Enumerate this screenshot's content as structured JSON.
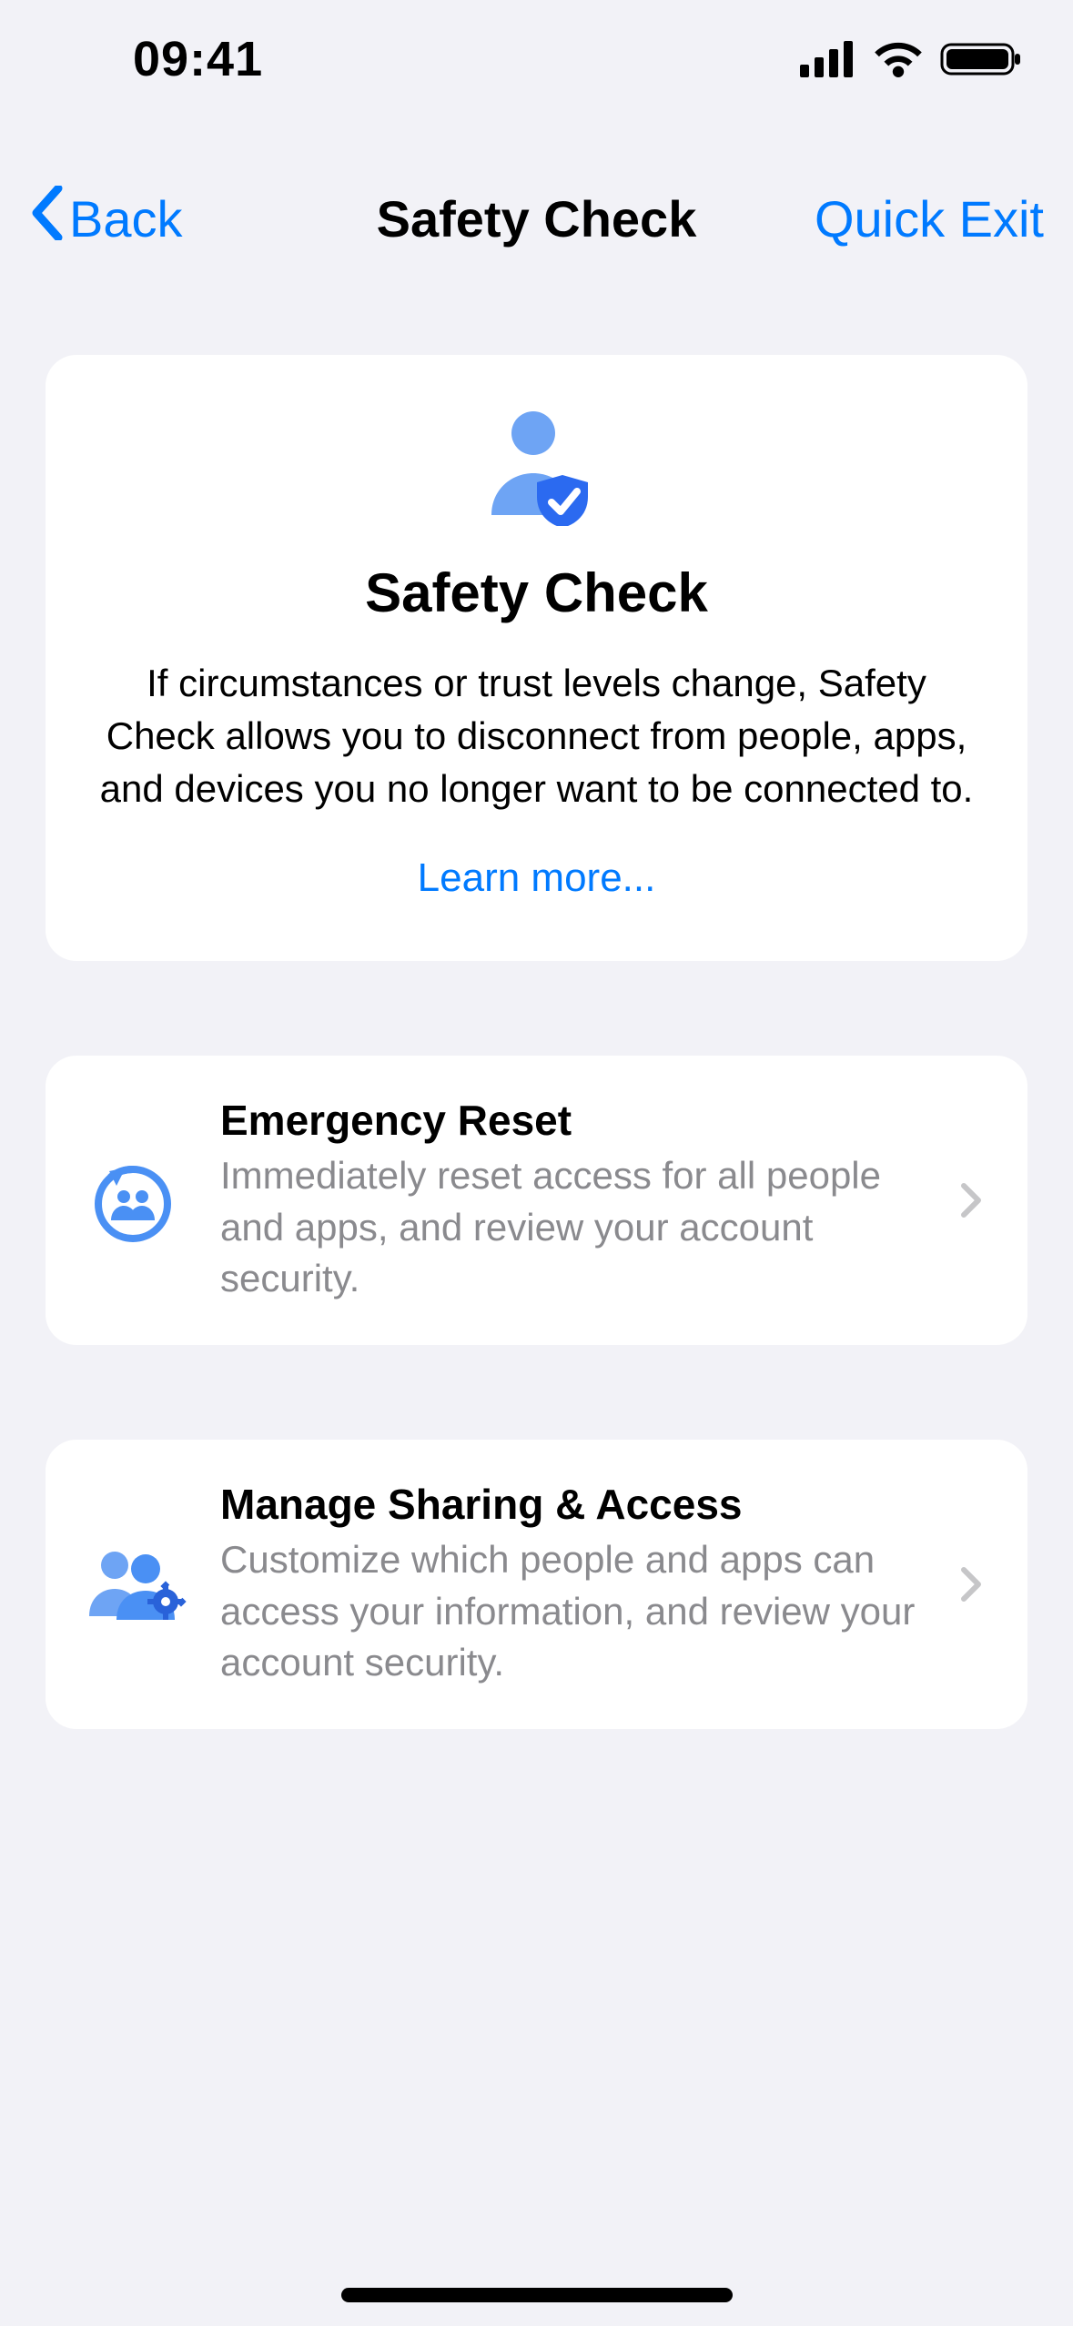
{
  "status": {
    "time": "09:41"
  },
  "nav": {
    "back_label": "Back",
    "title": "Safety Check",
    "quick_exit_label": "Quick Exit"
  },
  "hero": {
    "title": "Safety Check",
    "body": "If circumstances or trust levels change, Safety Check allows you to disconnect from people, apps, and devices you no longer want to be connected to.",
    "learn_more_label": "Learn more..."
  },
  "rows": {
    "emergency": {
      "title": "Emergency Reset",
      "sub": "Immediately reset access for all people and apps, and review your account security."
    },
    "manage": {
      "title": "Manage Sharing & Access",
      "sub": "Customize which people and apps can access your information, and review your account security."
    }
  },
  "colors": {
    "blue": "#2b7cf6",
    "link": "#007aff",
    "chevron": "#c6c6c8"
  }
}
